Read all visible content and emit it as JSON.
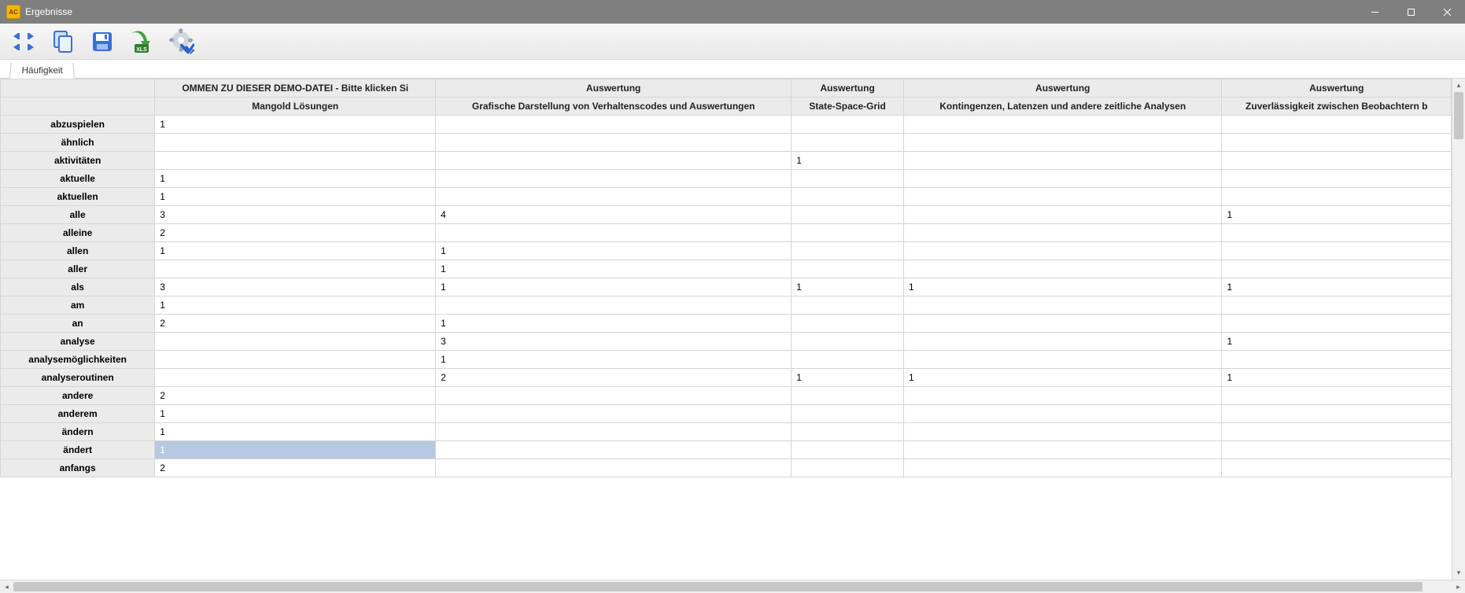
{
  "window": {
    "title": "Ergebnisse"
  },
  "tabs": [
    {
      "label": "Häufigkeit"
    }
  ],
  "grid": {
    "header_row1": [
      "",
      "OMMEN ZU DIESER DEMO-DATEI - Bitte klicken Si",
      "Auswertung",
      "Auswertung",
      "Auswertung",
      "Auswertung"
    ],
    "header_row2": [
      "",
      "Mangold Lösungen",
      "Grafische Darstellung von Verhaltenscodes und Auswertungen",
      "State-Space-Grid",
      "Kontingenzen, Latenzen und andere zeitliche Analysen",
      "Zuverlässigkeit zwischen Beobachtern b"
    ],
    "rows": [
      {
        "label": "abzuspielen",
        "cells": [
          "1",
          "",
          "",
          "",
          ""
        ]
      },
      {
        "label": "ähnlich",
        "cells": [
          "",
          "",
          "",
          "",
          ""
        ]
      },
      {
        "label": "aktivitäten",
        "cells": [
          "",
          "",
          "1",
          "",
          ""
        ]
      },
      {
        "label": "aktuelle",
        "cells": [
          "1",
          "",
          "",
          "",
          ""
        ]
      },
      {
        "label": "aktuellen",
        "cells": [
          "1",
          "",
          "",
          "",
          ""
        ]
      },
      {
        "label": "alle",
        "cells": [
          "3",
          "4",
          "",
          "",
          "1"
        ]
      },
      {
        "label": "alleine",
        "cells": [
          "2",
          "",
          "",
          "",
          ""
        ]
      },
      {
        "label": "allen",
        "cells": [
          "1",
          "1",
          "",
          "",
          ""
        ]
      },
      {
        "label": "aller",
        "cells": [
          "",
          "1",
          "",
          "",
          ""
        ]
      },
      {
        "label": "als",
        "cells": [
          "3",
          "1",
          "1",
          "1",
          "1"
        ]
      },
      {
        "label": "am",
        "cells": [
          "1",
          "",
          "",
          "",
          ""
        ]
      },
      {
        "label": "an",
        "cells": [
          "2",
          "1",
          "",
          "",
          ""
        ]
      },
      {
        "label": "analyse",
        "cells": [
          "",
          "3",
          "",
          "",
          "1"
        ]
      },
      {
        "label": "analysemöglichkeiten",
        "cells": [
          "",
          "1",
          "",
          "",
          ""
        ]
      },
      {
        "label": "analyseroutinen",
        "cells": [
          "",
          "2",
          "1",
          "1",
          "1"
        ]
      },
      {
        "label": "andere",
        "cells": [
          "2",
          "",
          "",
          "",
          ""
        ]
      },
      {
        "label": "anderem",
        "cells": [
          "1",
          "",
          "",
          "",
          ""
        ]
      },
      {
        "label": "ändern",
        "cells": [
          "1",
          "",
          "",
          "",
          ""
        ]
      },
      {
        "label": "ändert",
        "cells": [
          "1",
          "",
          "",
          "",
          ""
        ],
        "selected_col": 0
      },
      {
        "label": "anfangs",
        "cells": [
          "2",
          "",
          "",
          "",
          ""
        ]
      }
    ]
  }
}
